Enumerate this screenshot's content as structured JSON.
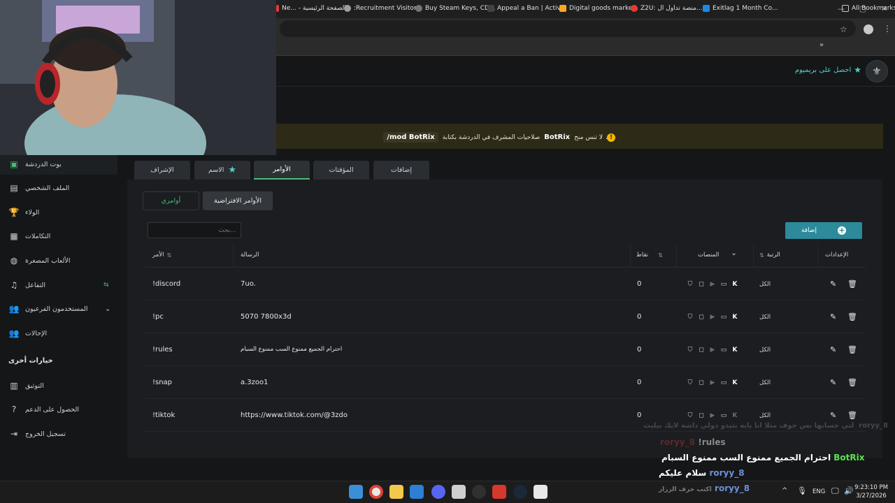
{
  "bookmarks": [
    {
      "label": "Ne... - الصفحة الرئيسية",
      "color": "#e53935"
    },
    {
      "label": ":Recruitment Visitor...",
      "color": "#9e9e9e"
    },
    {
      "label": "Buy Steam Keys, CD...",
      "color": "#757575"
    },
    {
      "label": "Appeal a Ban | Activ...",
      "color": "#424242"
    },
    {
      "label": "Digital goods marke...",
      "color": "#f9a825"
    },
    {
      "label": "Z2U: منصة تداول ال...",
      "color": "#e53935"
    },
    {
      "label": "Exitlag 1 Month Co...",
      "color": "#1e88e5"
    },
    {
      "label": "All Bookmarks",
      "color": "#9e9e9e"
    }
  ],
  "header": {
    "premium_label": "احصل على بريميوم"
  },
  "notice": {
    "command": "/mod BotRix",
    "text": "صلاحيات المشرف في الدردشة بكتابة",
    "botname": "BotRix",
    "suffix": "لا تنس منح"
  },
  "sidebar": {
    "items": [
      {
        "label": "بوت الدردشة",
        "icon": "robot-icon"
      },
      {
        "label": "الملف الشخصي",
        "icon": "profile-icon"
      },
      {
        "label": "الولاء",
        "icon": "trophy-icon"
      },
      {
        "label": "التكاملات",
        "icon": "integrations-icon"
      },
      {
        "label": "الألعاب المصغرة",
        "icon": "gamepad-icon"
      },
      {
        "label": "التفاعل",
        "icon": "music-icon"
      },
      {
        "label": "المستخدمون الفرعيون",
        "icon": "users-icon"
      },
      {
        "label": "الإحالات",
        "icon": "referrals-icon"
      }
    ],
    "other_title": "خيارات أخرى",
    "other_items": [
      {
        "label": "التوثيق",
        "icon": "docs-icon"
      },
      {
        "label": "الحصول على الدعم",
        "icon": "help-icon"
      },
      {
        "label": "تسجيل الخروج",
        "icon": "logout-icon"
      }
    ]
  },
  "tabs": [
    "إضافات",
    "المؤقتات",
    "الأوامر",
    "الاسم",
    "الإشراف"
  ],
  "subtabs": {
    "default": "الأوامر الافتراضية",
    "mine": "أوامري"
  },
  "search": {
    "placeholder": "بحث..."
  },
  "add_button": "إضافة",
  "columns": {
    "settings": "الإعدادات",
    "rank": "الرتبة",
    "platforms": "المنصات",
    "points": "نقاط",
    "message": "الرسالة",
    "command": "الأمر"
  },
  "rows": [
    {
      "command": "!discord",
      "message": "7uo.",
      "points": "0",
      "rank": "الكل"
    },
    {
      "command": "!pc",
      "message": "5070 7800x3d",
      "points": "0",
      "rank": "الكل"
    },
    {
      "command": "!rules",
      "message": "احترام الجميع ممنوع السب ممنوع السبام",
      "points": "0",
      "rank": "الكل"
    },
    {
      "command": "!snap",
      "message": "a.3zoo1",
      "points": "0",
      "rank": "الكل"
    },
    {
      "command": "!tiktok",
      "message": "https://www.tiktok.com/@3zdo",
      "points": "0",
      "rank": "الكل"
    }
  ],
  "chat": [
    {
      "user": "roryy_8",
      "text": "لتي حسابها بس جوف مثلا انا بابه يتيدو دولي داشه لايك بيليث",
      "user_color": "#6a6a6a",
      "text_color": "#6a6a6a"
    },
    {
      "user": "roryy_8",
      "text": "!rules",
      "user_color": "#5a2a2a",
      "text_color": "#8a8a8a"
    },
    {
      "user": "BotRix",
      "text": "احترام الجميع ممنوع السب ممنوع السبام",
      "user_color": "#5ee04f",
      "text_color": "#ffffff"
    },
    {
      "user": "roryy_8",
      "text": "سلام عليكم",
      "user_color": "#6f8fd8",
      "text_color": "#ffffff"
    },
    {
      "user": "roryy_8",
      "text": "اكتب حرف الزرار",
      "user_color": "#6f8fd8",
      "text_color": "#7a7a7a"
    }
  ],
  "taskbar": {
    "lang": "ENG",
    "time": "9:23:10 PM",
    "date": "3/27/2026"
  }
}
